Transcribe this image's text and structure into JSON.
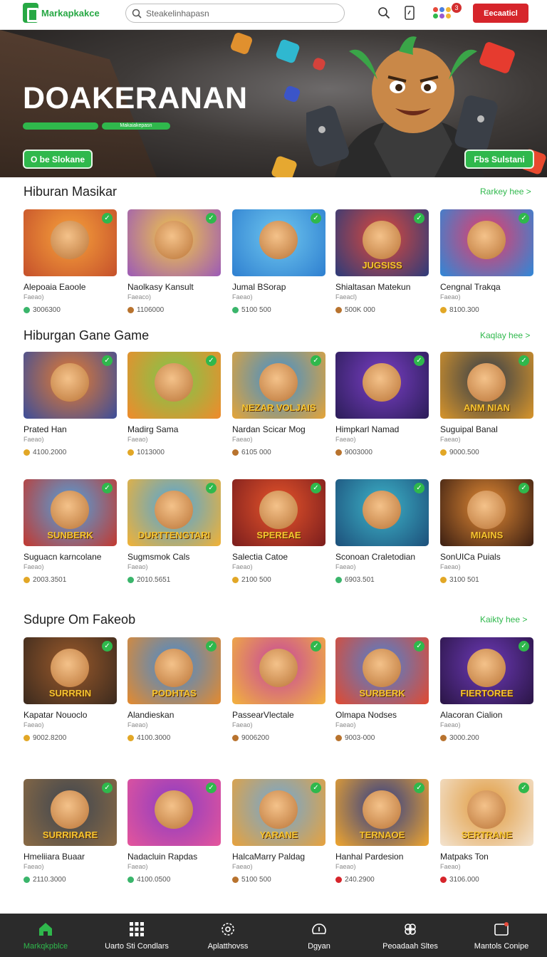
{
  "header": {
    "logo_text": "Markapkakce",
    "search_placeholder": "Steakelinhapasn",
    "cta_label": "Eecaaticl",
    "notification_count": "3"
  },
  "hero": {
    "title": "DOAKERANAN",
    "tag_text": "Makaiakepasn",
    "button_left": "O be Slokane",
    "button_right": "Fbs Sulstani"
  },
  "sections": [
    {
      "title": "Hiburan Masikar",
      "see_more": "Rarkey hee >",
      "cards": [
        {
          "title": "Alepoaia Eaoole",
          "sub": "Faeao)",
          "price": "3006300",
          "coin": "#3ab56b",
          "art": [
            "#f7a23b",
            "#c5502b"
          ],
          "label": ""
        },
        {
          "title": "Naolkasy Kansult",
          "sub": "Faeaco)",
          "price": "1106000",
          "coin": "#b8732e",
          "art": [
            "#f3c946",
            "#9c5ab7"
          ],
          "label": ""
        },
        {
          "title": "Jumal BSorap",
          "sub": "Faeao)",
          "price": "5100 500",
          "coin": "#3ab56b",
          "art": [
            "#6fc7ef",
            "#2e7fd0"
          ],
          "label": ""
        },
        {
          "title": "Shialtasan Matekun",
          "sub": "Faeacl)",
          "price": "500K 000",
          "coin": "#b8732e",
          "art": [
            "#e0493a",
            "#2c3b7a"
          ],
          "label": "JUGSISS"
        },
        {
          "title": "Cengnal Trakqa",
          "sub": "Faeao)",
          "price": "8100.300",
          "coin": "#e2a726",
          "art": [
            "#eb3b67",
            "#2e88d8"
          ],
          "label": ""
        }
      ]
    },
    {
      "title": "Hiburgan Gane Game",
      "see_more": "Kaqlay hee >",
      "cards": [
        {
          "title": "Prated Han",
          "sub": "Faeao)",
          "price": "4100.2000",
          "coin": "#e2a726",
          "art": [
            "#e97c2e",
            "#3b4d9a"
          ],
          "label": ""
        },
        {
          "title": "Madirg Sama",
          "sub": "Faeao)",
          "price": "1013000",
          "coin": "#e2a726",
          "art": [
            "#7bc94c",
            "#f08a2b"
          ],
          "label": ""
        },
        {
          "title": "Nardan Scicar Mog",
          "sub": "Faeao)",
          "price": "6105 000",
          "coin": "#b8732e",
          "art": [
            "#3c8fd3",
            "#e6a436"
          ],
          "label": "NEZAR VOLJAIS"
        },
        {
          "title": "Himpkarl Namad",
          "sub": "Faeao)",
          "price": "9003000",
          "coin": "#b8732e",
          "art": [
            "#7a3fc5",
            "#2b1d58"
          ],
          "label": ""
        },
        {
          "title": "Suguipal Banal",
          "sub": "Faeao)",
          "price": "9000.500",
          "coin": "#e2a726",
          "art": [
            "#2e3a4a",
            "#d8952b"
          ],
          "label": "ANM NIAN"
        }
      ]
    },
    {
      "title": "",
      "see_more": "",
      "cards": [
        {
          "title": "Suguacn karncolane",
          "sub": "Faeao)",
          "price": "2003.3501",
          "coin": "#e2a726",
          "art": [
            "#4fa3e0",
            "#c3382f"
          ],
          "label": "SUNBERK"
        },
        {
          "title": "Sugmsmok Cals",
          "sub": "Faeao)",
          "price": "2010.5651",
          "coin": "#3ab56b",
          "art": [
            "#4aa5e0",
            "#f2b235"
          ],
          "label": "DURTTENGTARI"
        },
        {
          "title": "Salectia Catoe",
          "sub": "Faeao)",
          "price": "2100 500",
          "coin": "#e2a726",
          "art": [
            "#e8552b",
            "#7a1d1d"
          ],
          "label": "SPEREAE"
        },
        {
          "title": "Sconoan Craletodian",
          "sub": "Faeao)",
          "price": "6903.501",
          "coin": "#3ab56b",
          "art": [
            "#3eb4c9",
            "#1c4f7a"
          ],
          "label": ""
        },
        {
          "title": "SonUICa Puials",
          "sub": "Faeao)",
          "price": "3100 501",
          "coin": "#e2a726",
          "art": [
            "#e48b35",
            "#3a1e12"
          ],
          "label": "MIAINS"
        }
      ]
    },
    {
      "title": "Sdupre Om Fakeob",
      "see_more": "Kaikty hee >",
      "cards": [
        {
          "title": "Kapatar Nouoclo",
          "sub": "Faeao)",
          "price": "9002.8200",
          "coin": "#e2a726",
          "art": [
            "#9b5a2b",
            "#3b2a1e"
          ],
          "label": "SURRRIN"
        },
        {
          "title": "Alandieskan",
          "sub": "Faeao)",
          "price": "4100.3000",
          "coin": "#e2a726",
          "art": [
            "#3f8bd8",
            "#e58a2d"
          ],
          "label": "PODHTAS"
        },
        {
          "title": "PassearVlectale",
          "sub": "Faeao)",
          "price": "9006200",
          "coin": "#b8732e",
          "art": [
            "#c544a0",
            "#f3b33c"
          ],
          "label": ""
        },
        {
          "title": "Olmapa Nodses",
          "sub": "Faeao)",
          "price": "9003-000",
          "coin": "#b8732e",
          "art": [
            "#4a83d6",
            "#e2492f"
          ],
          "label": "SURBERK"
        },
        {
          "title": "Alacoran Cialion",
          "sub": "Faeao)",
          "price": "3000.200",
          "coin": "#b8732e",
          "art": [
            "#6d3ab8",
            "#2a1545"
          ],
          "label": "FIERTOREE"
        }
      ]
    },
    {
      "title": "",
      "see_more": "",
      "cards": [
        {
          "title": "Hmeliiara Buaar",
          "sub": "Faeao)",
          "price": "2110.3000",
          "coin": "#3ab56b",
          "art": [
            "#3d4550",
            "#8a6a44"
          ],
          "label": "SURRIRARE"
        },
        {
          "title": "Nadacluin Rapdas",
          "sub": "Faeao)",
          "price": "4100.0500",
          "coin": "#3ab56b",
          "art": [
            "#8a3cc4",
            "#e5559b"
          ],
          "label": ""
        },
        {
          "title": "HalcaMarry Paldag",
          "sub": "Faeao)",
          "price": "5100 500",
          "coin": "#b8732e",
          "art": [
            "#6fa7d6",
            "#e8a23c"
          ],
          "label": "YARANE"
        },
        {
          "title": "Hanhal Pardesion",
          "sub": "Faeao)",
          "price": "240.2900",
          "coin": "#d6252b",
          "art": [
            "#2a3a8a",
            "#f0a62e"
          ],
          "label": "TERNAOE"
        },
        {
          "title": "Matpaks Ton",
          "sub": "Faeao)",
          "price": "3106.000",
          "coin": "#d6252b",
          "art": [
            "#e09a3d",
            "#f3e3cf"
          ],
          "label": "SERTRANE"
        }
      ]
    }
  ],
  "bottom_nav": [
    {
      "label": "Markqkpblce",
      "icon": "home-icon",
      "active": true
    },
    {
      "label": "Uarto Sti Condlars",
      "icon": "grid-icon",
      "active": false
    },
    {
      "label": "Aplatthovss",
      "icon": "settings-icon",
      "active": false
    },
    {
      "label": "Dgyan",
      "icon": "gauge-icon",
      "active": false
    },
    {
      "label": "Peoadaah Sltes",
      "icon": "flower-icon",
      "active": false
    },
    {
      "label": "Mantols Conipe",
      "icon": "window-icon",
      "active": false
    }
  ]
}
